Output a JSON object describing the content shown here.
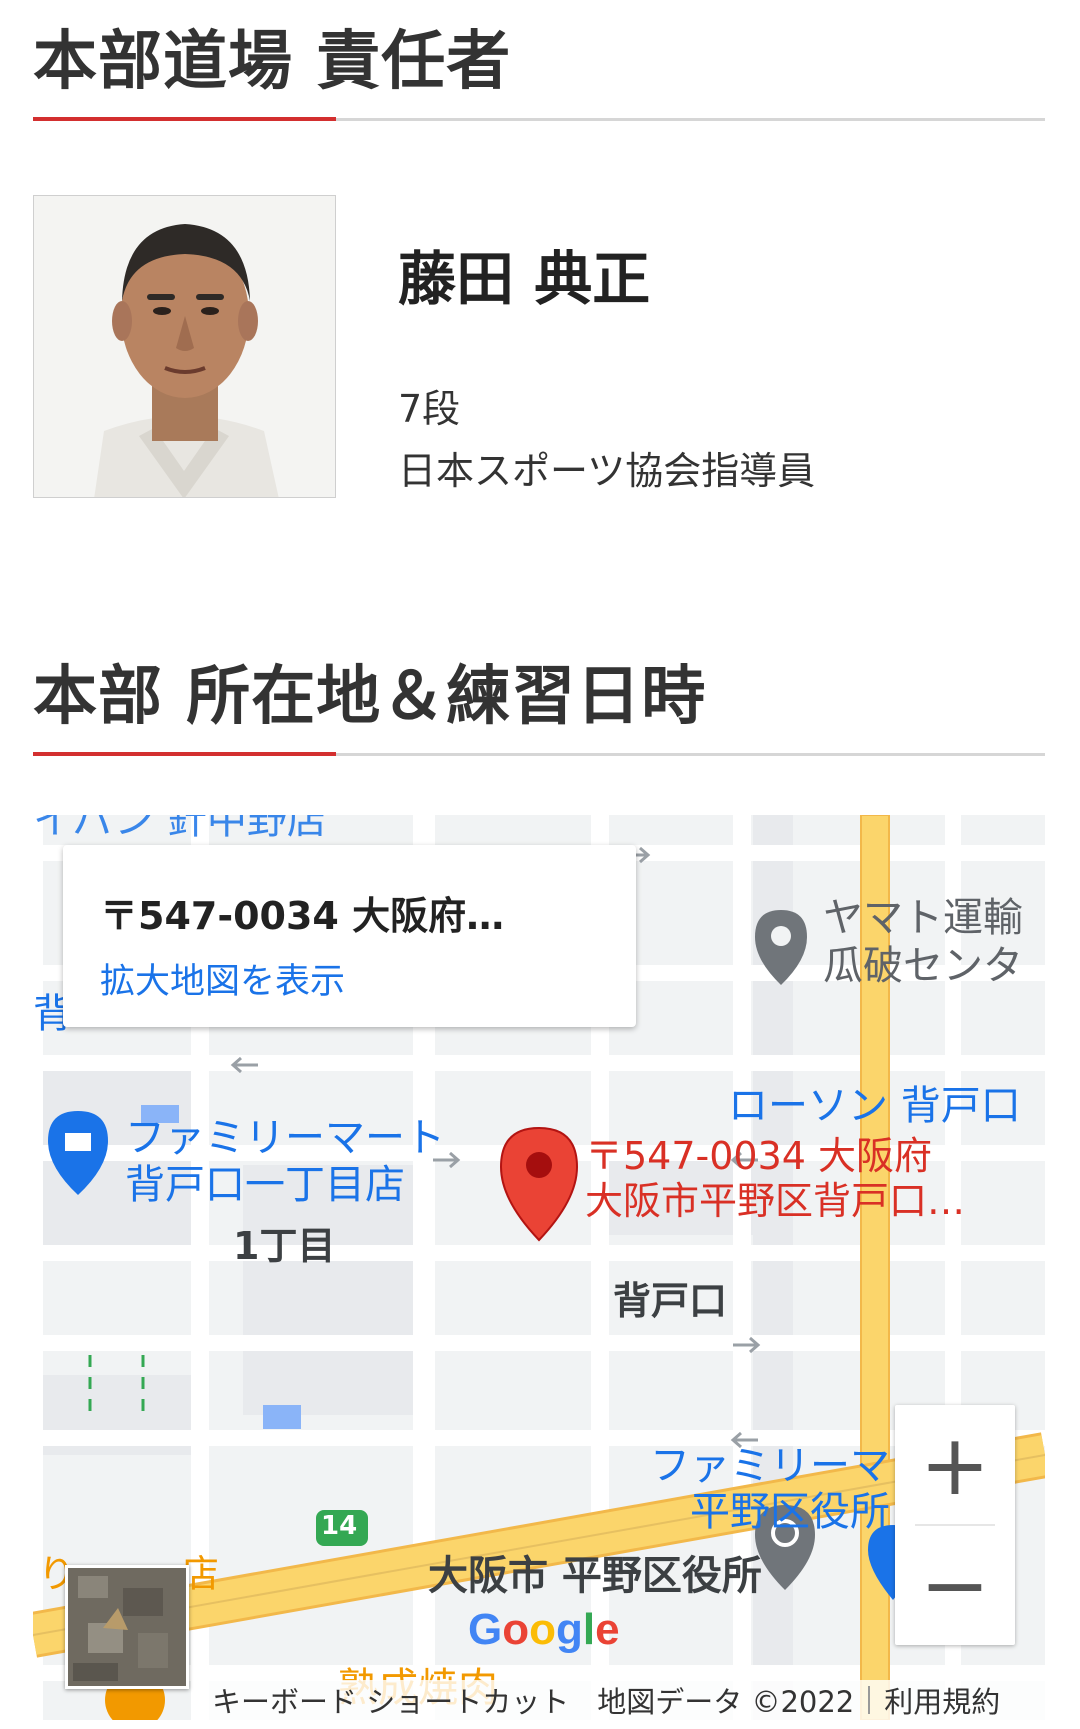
{
  "instructor_section": {
    "title": "本部道場 責任者",
    "name": "藤田 典正",
    "rank": "7段",
    "qualification": "日本スポーツ協会指導員"
  },
  "location_section": {
    "title": "本部 所在地＆練習日時"
  },
  "map": {
    "card": {
      "address": "〒547-0034 大阪府…",
      "link": "拡大地図を表示"
    },
    "labels": {
      "top_cut": "イパン 針中野店",
      "yamato_line1": "ヤマト運輸",
      "yamato_line2": "瓜破センタ",
      "left_cut": "背",
      "lawson": "ローソン 背戸口",
      "familymart_line1": "ファミリーマート",
      "familymart_line2": "背戸口一丁目店",
      "pin_line1": "〒547-0034 大阪府",
      "pin_line2": "大阪市平野区背戸口…",
      "chome": "1丁目",
      "setoguchi": "背戸口",
      "route": "14",
      "familymart2_line1": "ファミリーマ",
      "familymart2_line2": "平野区役所",
      "ward_office": "大阪市 平野区役所",
      "bottom_left_cut": "り",
      "bottom_left_cut2": "店",
      "jukusei": "熟成焼肉"
    },
    "google": [
      "G",
      "o",
      "o",
      "g",
      "l",
      "e"
    ],
    "google_colors": [
      "#4285f4",
      "#ea4335",
      "#fbbc05",
      "#4285f4",
      "#34a853",
      "#ea4335"
    ],
    "zoom_in": "+",
    "zoom_out": "−",
    "attribution": {
      "shortcuts": "キーボード ショートカット",
      "map_data": "地図データ ©2022",
      "terms": "利用規約"
    },
    "colors": {
      "land": "#f1f3f4",
      "road": "#ffffff",
      "major_road": "#fbd56b",
      "pin": "#ea4335",
      "poi_blue": "#1a73e8"
    }
  }
}
